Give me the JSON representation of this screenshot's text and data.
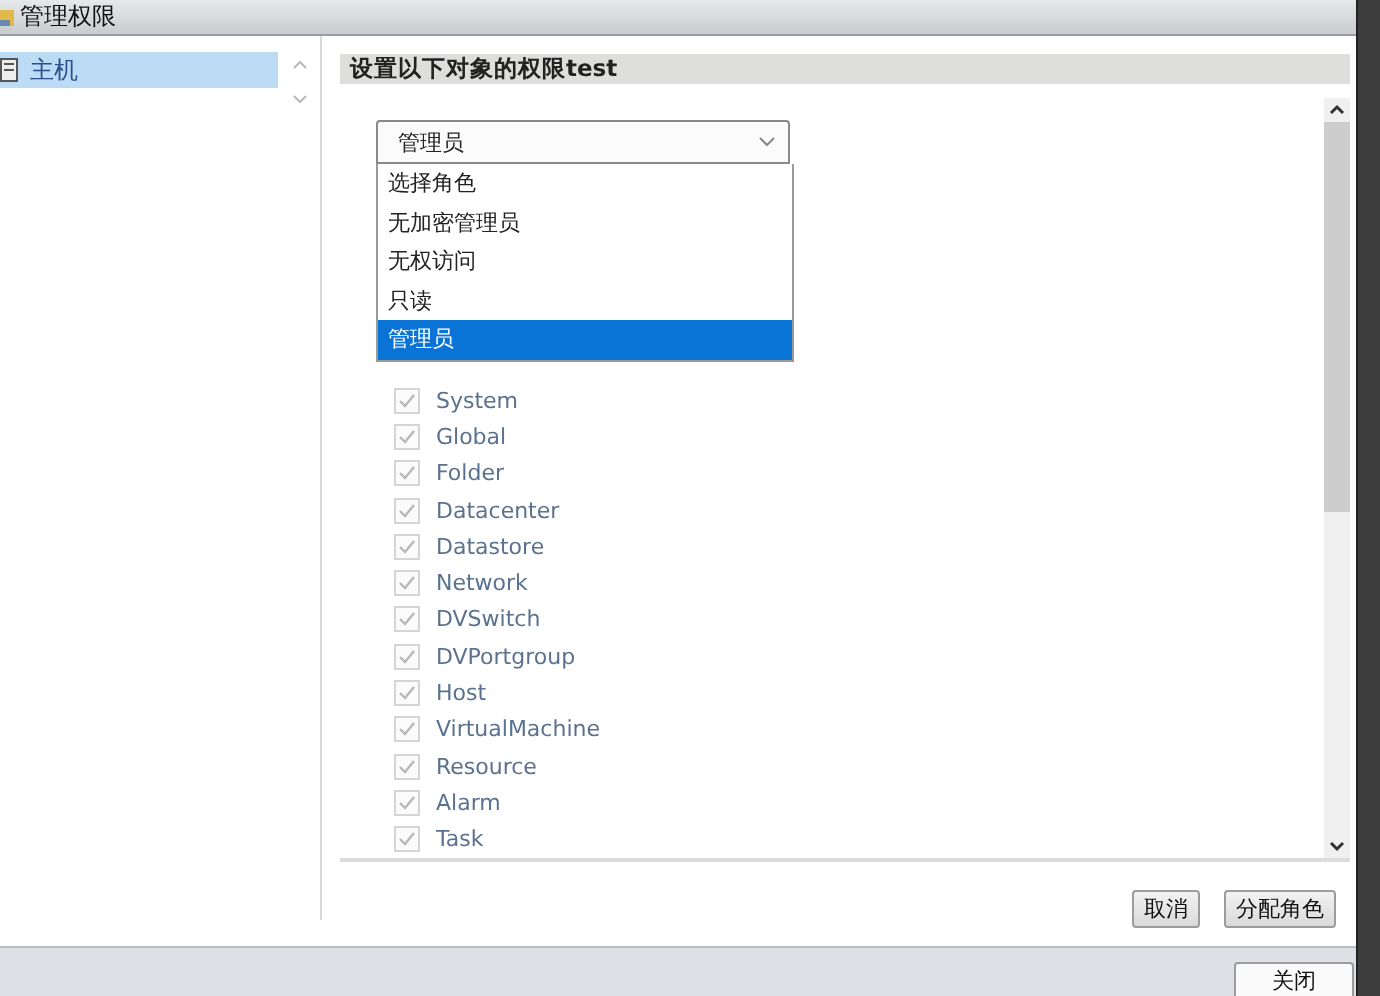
{
  "window": {
    "title": "管理权限"
  },
  "sidebar": {
    "items": [
      {
        "label": "主机",
        "selected": true
      }
    ]
  },
  "header": "设置以下对象的权限test",
  "role_select": {
    "value": "管理员",
    "expanded": true,
    "options": [
      {
        "label": "选择角色",
        "selected": false
      },
      {
        "label": "无加密管理员",
        "selected": false
      },
      {
        "label": "无权访问",
        "selected": false
      },
      {
        "label": "只读",
        "selected": false
      },
      {
        "label": "管理员",
        "selected": true
      }
    ]
  },
  "permissions": [
    {
      "label": "System",
      "checked": true,
      "disabled": true
    },
    {
      "label": "Global",
      "checked": true,
      "disabled": true
    },
    {
      "label": "Folder",
      "checked": true,
      "disabled": true
    },
    {
      "label": "Datacenter",
      "checked": true,
      "disabled": true
    },
    {
      "label": "Datastore",
      "checked": true,
      "disabled": true
    },
    {
      "label": "Network",
      "checked": true,
      "disabled": true
    },
    {
      "label": "DVSwitch",
      "checked": true,
      "disabled": true
    },
    {
      "label": "DVPortgroup",
      "checked": true,
      "disabled": true
    },
    {
      "label": "Host",
      "checked": true,
      "disabled": true
    },
    {
      "label": "VirtualMachine",
      "checked": true,
      "disabled": true
    },
    {
      "label": "Resource",
      "checked": true,
      "disabled": true
    },
    {
      "label": "Alarm",
      "checked": true,
      "disabled": true
    },
    {
      "label": "Task",
      "checked": true,
      "disabled": true
    }
  ],
  "buttons": [
    "取消",
    "分配角色"
  ],
  "footer_button": "关闭"
}
